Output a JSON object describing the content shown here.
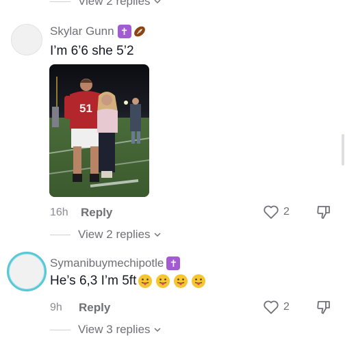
{
  "comments": [
    {
      "username": "Skylar Gunn",
      "badges": [
        "cross-badge-icon",
        "football-icon"
      ],
      "text": "I’m 6’6 she 5’2",
      "has_photo": true,
      "time": "16h",
      "reply_label": "Reply",
      "likes": "2",
      "view_replies": "View 2 replies"
    },
    {
      "username": "Symanibuymechipotle",
      "badges": [
        "cross-badge-icon"
      ],
      "text": "He’s 6,3 I’m 5ft",
      "emojis": [
        "tongue-face-icon",
        "tongue-face-icon",
        "tongue-face-icon",
        "tongue-face-icon"
      ],
      "time": "9h",
      "reply_label": "Reply",
      "likes": "2",
      "view_replies": "View 3 replies"
    }
  ],
  "previous_thread": {
    "view_replies": "View 2 replies"
  },
  "colors": {
    "accent_ring": "#58c7d6",
    "badge_purple": "#a35bd1",
    "muted_text": "#6f7075"
  },
  "photo": {
    "jersey_number": "51"
  }
}
